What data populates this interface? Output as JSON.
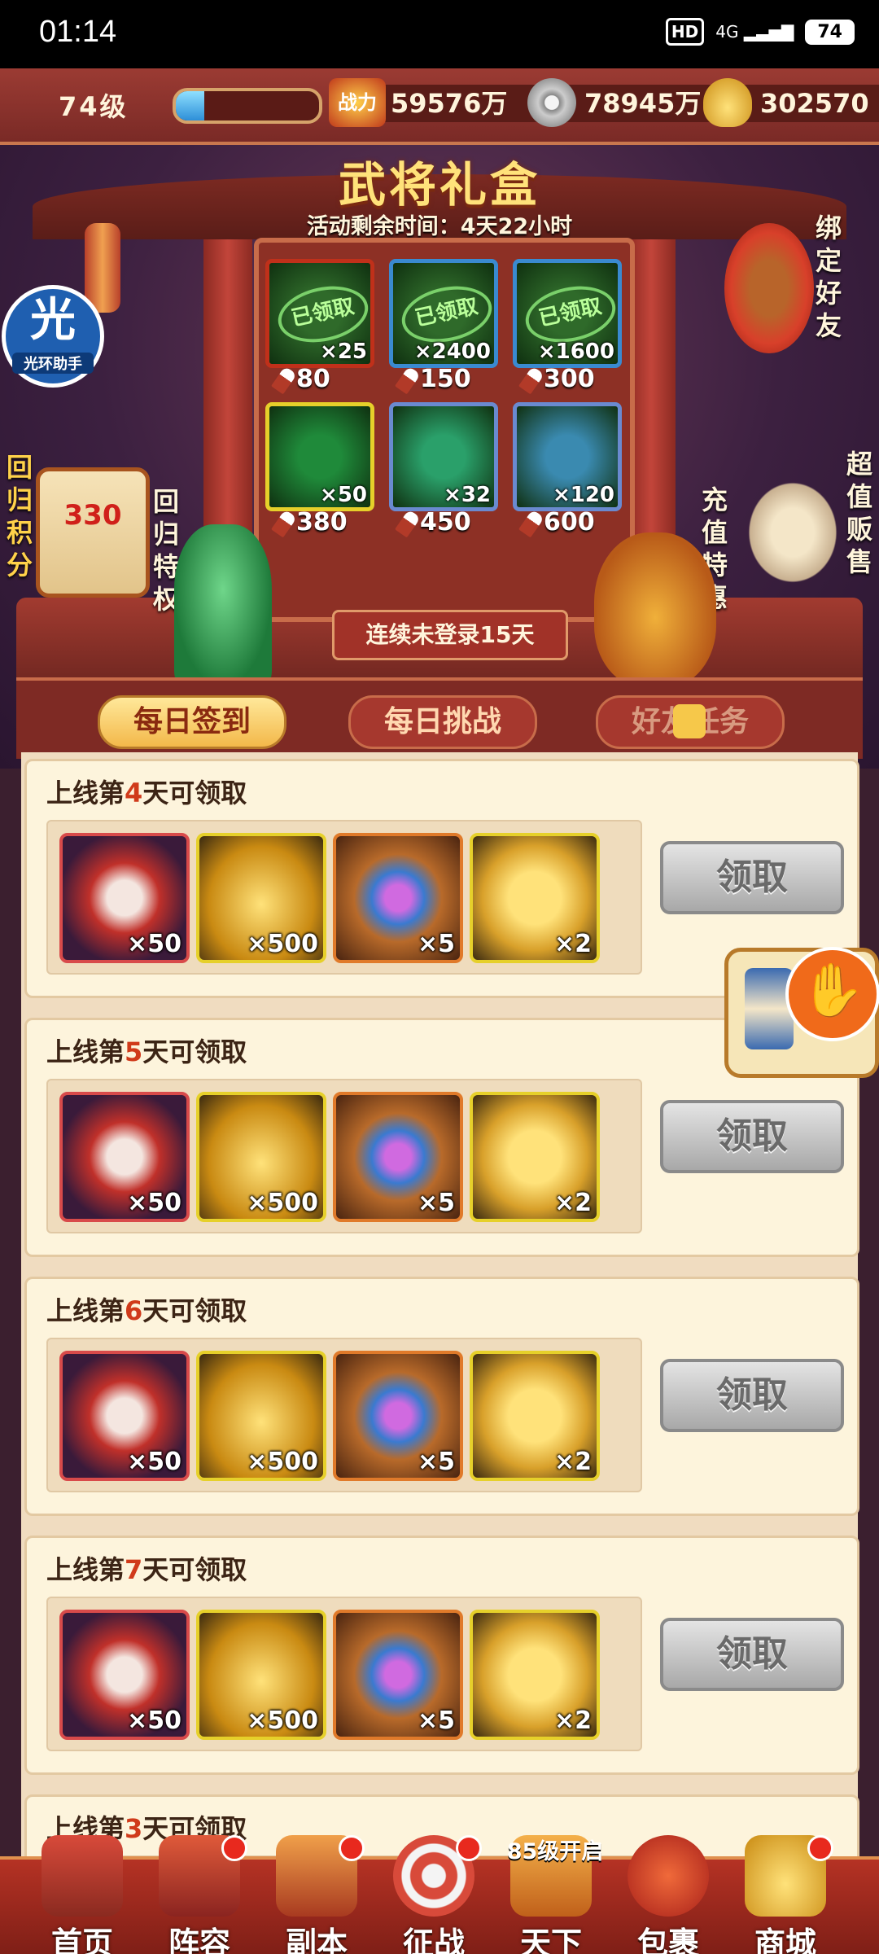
{
  "status_bar": {
    "time": "01:14",
    "hd": "HD",
    "network": "4G",
    "battery": "74"
  },
  "top_bar": {
    "level": "74级",
    "exp_fraction": 0.2,
    "power_label": "战力",
    "power": "59576万",
    "coins": "78945万",
    "ingots": "302570"
  },
  "event": {
    "title": "武将礼盒",
    "timer": "活动剩余时间：4天22小时",
    "streak": "连续未登录15天"
  },
  "helper": {
    "glyph": "光",
    "label": "光环助手"
  },
  "side": {
    "bind_friend": "绑定好友",
    "return_points_label": "回归积分",
    "return_points_value": "330",
    "return_privilege": "回归特权",
    "recharge_deal": "充值特惠",
    "super_value": "超值贩售"
  },
  "shop_grid": [
    {
      "count": "×25",
      "price": "80",
      "claimed": "已领取",
      "color": "#2f6a2a"
    },
    {
      "count": "×2400",
      "price": "150",
      "claimed": "已领取",
      "color": "#2f6a2a"
    },
    {
      "count": "×1600",
      "price": "300",
      "claimed": "已领取",
      "color": "#2f6a2a"
    },
    {
      "count": "×50",
      "price": "380",
      "claimed": "",
      "color": "#1f8a3a"
    },
    {
      "count": "×32",
      "price": "450",
      "claimed": "",
      "color": "#2aa06a"
    },
    {
      "count": "×120",
      "price": "600",
      "claimed": "",
      "color": "#3a8ab0"
    }
  ],
  "tabs": [
    "每日签到",
    "每日挑战",
    "好友任务"
  ],
  "cards": [
    {
      "prefix": "上线第",
      "day": "4",
      "suffix": "天可领取",
      "items": [
        "×50",
        "×500",
        "×5",
        "×2"
      ],
      "claim": "领取"
    },
    {
      "prefix": "上线第",
      "day": "5",
      "suffix": "天可领取",
      "items": [
        "×50",
        "×500",
        "×5",
        "×2"
      ],
      "claim": "领取"
    },
    {
      "prefix": "上线第",
      "day": "6",
      "suffix": "天可领取",
      "items": [
        "×50",
        "×500",
        "×5",
        "×2"
      ],
      "claim": "领取"
    },
    {
      "prefix": "上线第",
      "day": "7",
      "suffix": "天可领取",
      "items": [
        "×50",
        "×500",
        "×5",
        "×2"
      ],
      "claim": "领取"
    },
    {
      "prefix": "上线第",
      "day": "3",
      "suffix": "天可领取",
      "items": [],
      "claim": ""
    }
  ],
  "nav": {
    "home": "首页",
    "lineup": "阵容",
    "dungeon": "副本",
    "campaign": "征战",
    "world": "天下",
    "world_badge": "85级开启",
    "bag": "包裹",
    "shop": "商城"
  }
}
